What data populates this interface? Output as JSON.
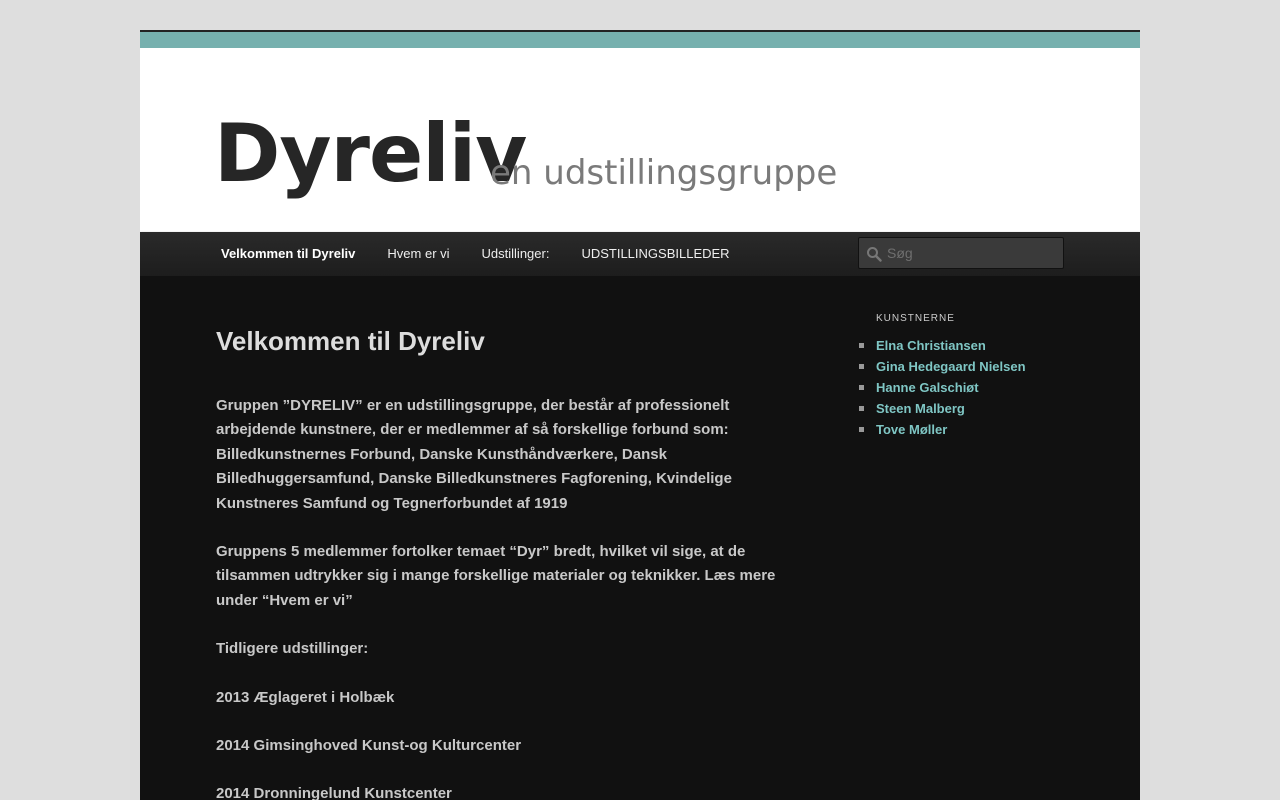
{
  "site": {
    "title": "Dyreliv",
    "tagline": "en udstillingsgruppe"
  },
  "nav": {
    "items": [
      {
        "label": "Velkommen til Dyreliv",
        "current": true
      },
      {
        "label": "Hvem er vi",
        "current": false
      },
      {
        "label": "Udstillinger:",
        "current": false
      },
      {
        "label": "UDSTILLINGSBILLEDER",
        "current": false
      }
    ]
  },
  "search": {
    "placeholder": "Søg",
    "value": ""
  },
  "main": {
    "title": "Velkommen til Dyreliv",
    "paragraphs": [
      "Gruppen  ”DYRELIV” er en udstillingsgruppe, der består af professionelt arbejdende kunstnere, der er medlemmer af så forskellige forbund som: Billedkunstnernes Forbund, Danske Kunsthåndværkere, Dansk Billedhuggersamfund,  Danske Billedkunstneres Fagforening,  Kvindelige Kunstneres Samfund og Tegnerforbundet af 1919",
      "Gruppens 5 medlemmer fortolker temaet “Dyr” bredt, hvilket vil sige, at de tilsammen udtrykker sig i mange forskellige materialer og teknikker. Læs mere under “Hvem er vi”",
      "Tidligere udstillinger:",
      "2013 Æglageret i Holbæk",
      "2014 Gimsinghoved Kunst-og Kulturcenter",
      "2014 Dronningelund Kunstcenter"
    ]
  },
  "sidebar": {
    "widget_title": "KUNSTNERNE",
    "artists": [
      "Elna Christiansen",
      "Gina Hedegaard Nielsen",
      "Hanne Galschiøt",
      "Steen Malberg",
      "Tove Møller"
    ]
  },
  "colors": {
    "accent_bar": "#76b0ae",
    "link": "#7fc6c4",
    "content_bg": "#111111",
    "page_bg": "#dedede"
  },
  "icons": {
    "search": "search-icon"
  }
}
